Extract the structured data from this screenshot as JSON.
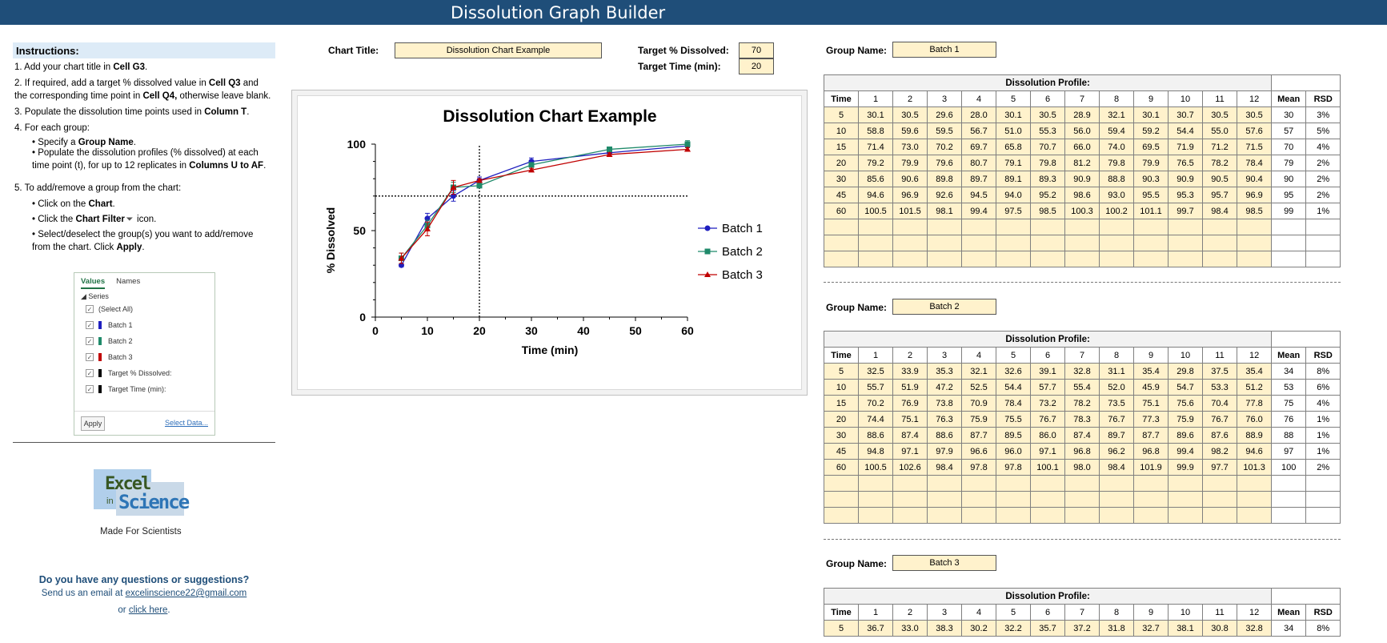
{
  "app": {
    "title": "Dissolution Graph Builder"
  },
  "instructions": {
    "heading": "Instructions:",
    "step1_pre": "1. Add your chart title in ",
    "step1_cell": "Cell G3",
    "step1_post": ".",
    "step2_pre": "2. If required, add a target % dissolved value in ",
    "step2_cell1": "Cell Q3",
    "step2_mid": " and the corresponding time point in ",
    "step2_cell2": "Cell Q4,",
    "step2_post": " otherwise leave blank.",
    "step3_pre": "3. Populate the dissolution time points used in ",
    "step3_cell": "Column T",
    "step3_post": ".",
    "step4": "4. For each group:",
    "step4a_pre": "• Specify a ",
    "step4a_b": "Group Name",
    "step4a_post": ".",
    "step4b_pre": "• Populate the dissolution profiles (% dissolved) at each time point (t), for up to 12 replicates in ",
    "step4b_b": "Columns U to AF",
    "step4b_post": ".",
    "step5": "5. To add/remove a group from the chart:",
    "step5a_pre": "• Click on the ",
    "step5a_b": "Chart",
    "step5a_post": ".",
    "step5b_pre": "• Click the ",
    "step5b_b": "Chart Filter",
    "step5b_post": " icon.",
    "step5c_pre": "• Select/deselect the group(s) you want to add/remove from the chart. Click ",
    "step5c_b": "Apply",
    "step5c_post": "."
  },
  "filter_panel": {
    "tabs": [
      "Values",
      "Names"
    ],
    "series_label": "◢ Series",
    "items": [
      {
        "label": "(Select All)",
        "color": ""
      },
      {
        "label": "Batch 1",
        "color": "#1f1fbf"
      },
      {
        "label": "Batch 2",
        "color": "#1f8a6a"
      },
      {
        "label": "Batch 3",
        "color": "#c00000"
      },
      {
        "label": "Target % Dissolved:",
        "color": "#000000"
      },
      {
        "label": "Target Time (min):",
        "color": "#000000"
      }
    ],
    "apply_label": "Apply",
    "select_data_label": "Select Data..."
  },
  "branding": {
    "logo_word1": "Excel",
    "logo_word2": "in",
    "logo_word3": "Science",
    "tagline": "Made For Scientists"
  },
  "contact": {
    "question": "Do you have any questions or suggestions?",
    "email_pre": "Send us an email at ",
    "email": "excelinscience22@gmail.com",
    "or_pre": "or ",
    "click_here": "click here",
    "or_post": "."
  },
  "chart_settings": {
    "title_label": "Chart Title:",
    "title_value": "Dissolution Chart Example",
    "target_pct_label": "Target % Dissolved:",
    "target_pct_value": "70",
    "target_time_label": "Target Time (min):",
    "target_time_value": "20"
  },
  "chart_data": {
    "type": "line",
    "title": "Dissolution Chart Example",
    "xlabel": "Time (min)",
    "ylabel": "% Dissolved",
    "xlim": [
      0,
      60
    ],
    "ylim": [
      0,
      100
    ],
    "xticks": [
      0,
      10,
      20,
      30,
      40,
      50,
      60
    ],
    "yticks": [
      0,
      50,
      100
    ],
    "x": [
      5,
      10,
      15,
      20,
      30,
      45,
      60
    ],
    "legend_position": "right",
    "target_pct": 70,
    "target_time": 20,
    "series": [
      {
        "name": "Batch 1",
        "color": "#1f1fbf",
        "marker": "circle",
        "values": [
          30,
          57,
          70,
          79,
          90,
          95,
          99
        ],
        "err": [
          1,
          3,
          3,
          2,
          2,
          2,
          1
        ]
      },
      {
        "name": "Batch 2",
        "color": "#1f8a6a",
        "marker": "square",
        "values": [
          34,
          53,
          75,
          76,
          88,
          97,
          100
        ],
        "err": [
          3,
          3,
          3,
          1,
          1,
          1,
          2
        ]
      },
      {
        "name": "Batch 3",
        "color": "#c00000",
        "marker": "triangle",
        "values": [
          34,
          51,
          75,
          79,
          85,
          94,
          97
        ],
        "err": [
          3,
          4,
          4,
          1,
          1,
          1,
          1
        ]
      }
    ]
  },
  "tables": {
    "caption": "Dissolution Profile:",
    "group_label": "Group Name:",
    "headers": [
      "Time",
      "1",
      "2",
      "3",
      "4",
      "5",
      "6",
      "7",
      "8",
      "9",
      "10",
      "11",
      "12",
      "Mean",
      "RSD"
    ],
    "groups": [
      {
        "name": "Batch 1",
        "rows": [
          [
            "5",
            "30.1",
            "30.5",
            "29.6",
            "28.0",
            "30.1",
            "30.5",
            "28.9",
            "32.1",
            "30.1",
            "30.7",
            "30.5",
            "30.5",
            "30",
            "3%"
          ],
          [
            "10",
            "58.8",
            "59.6",
            "59.5",
            "56.7",
            "51.0",
            "55.3",
            "56.0",
            "59.4",
            "59.2",
            "54.4",
            "55.0",
            "57.6",
            "57",
            "5%"
          ],
          [
            "15",
            "71.4",
            "73.0",
            "70.2",
            "69.7",
            "65.8",
            "70.7",
            "66.0",
            "74.0",
            "69.5",
            "71.9",
            "71.2",
            "71.5",
            "70",
            "4%"
          ],
          [
            "20",
            "79.2",
            "79.9",
            "79.6",
            "80.7",
            "79.1",
            "79.8",
            "81.2",
            "79.8",
            "79.9",
            "76.5",
            "78.2",
            "78.4",
            "79",
            "2%"
          ],
          [
            "30",
            "85.6",
            "90.6",
            "89.8",
            "89.7",
            "89.1",
            "89.3",
            "90.9",
            "88.8",
            "90.3",
            "90.9",
            "90.5",
            "90.4",
            "90",
            "2%"
          ],
          [
            "45",
            "94.6",
            "96.9",
            "92.6",
            "94.5",
            "94.0",
            "95.2",
            "98.6",
            "93.0",
            "95.5",
            "95.3",
            "95.7",
            "96.9",
            "95",
            "2%"
          ],
          [
            "60",
            "100.5",
            "101.5",
            "98.1",
            "99.4",
            "97.5",
            "98.5",
            "100.3",
            "100.2",
            "101.1",
            "99.7",
            "98.4",
            "98.5",
            "99",
            "1%"
          ],
          [
            "",
            "",
            "",
            "",
            "",
            "",
            "",
            "",
            "",
            "",
            "",
            "",
            "",
            "",
            ""
          ],
          [
            "",
            "",
            "",
            "",
            "",
            "",
            "",
            "",
            "",
            "",
            "",
            "",
            "",
            "",
            ""
          ],
          [
            "",
            "",
            "",
            "",
            "",
            "",
            "",
            "",
            "",
            "",
            "",
            "",
            "",
            "",
            ""
          ]
        ]
      },
      {
        "name": "Batch 2",
        "rows": [
          [
            "5",
            "32.5",
            "33.9",
            "35.3",
            "32.1",
            "32.6",
            "39.1",
            "32.8",
            "31.1",
            "35.4",
            "29.8",
            "37.5",
            "35.4",
            "34",
            "8%"
          ],
          [
            "10",
            "55.7",
            "51.9",
            "47.2",
            "52.5",
            "54.4",
            "57.7",
            "55.4",
            "52.0",
            "45.9",
            "54.7",
            "53.3",
            "51.2",
            "53",
            "6%"
          ],
          [
            "15",
            "70.2",
            "76.9",
            "73.8",
            "70.9",
            "78.4",
            "73.2",
            "78.2",
            "73.5",
            "75.1",
            "75.6",
            "70.4",
            "77.8",
            "75",
            "4%"
          ],
          [
            "20",
            "74.4",
            "75.1",
            "76.3",
            "75.9",
            "75.5",
            "76.7",
            "78.3",
            "76.7",
            "77.3",
            "75.9",
            "76.7",
            "76.0",
            "76",
            "1%"
          ],
          [
            "30",
            "88.6",
            "87.4",
            "88.6",
            "87.7",
            "89.5",
            "86.0",
            "87.4",
            "89.7",
            "87.7",
            "89.6",
            "87.6",
            "88.9",
            "88",
            "1%"
          ],
          [
            "45",
            "94.8",
            "97.1",
            "97.9",
            "96.6",
            "96.0",
            "97.1",
            "96.8",
            "96.2",
            "96.8",
            "99.4",
            "98.2",
            "94.6",
            "97",
            "1%"
          ],
          [
            "60",
            "100.5",
            "102.6",
            "98.4",
            "97.8",
            "97.8",
            "100.1",
            "98.0",
            "98.4",
            "101.9",
            "99.9",
            "97.7",
            "101.3",
            "100",
            "2%"
          ],
          [
            "",
            "",
            "",
            "",
            "",
            "",
            "",
            "",
            "",
            "",
            "",
            "",
            "",
            "",
            ""
          ],
          [
            "",
            "",
            "",
            "",
            "",
            "",
            "",
            "",
            "",
            "",
            "",
            "",
            "",
            "",
            ""
          ],
          [
            "",
            "",
            "",
            "",
            "",
            "",
            "",
            "",
            "",
            "",
            "",
            "",
            "",
            "",
            ""
          ]
        ]
      },
      {
        "name": "Batch 3",
        "rows": [
          [
            "5",
            "36.7",
            "33.0",
            "38.3",
            "30.2",
            "32.2",
            "35.7",
            "37.2",
            "31.8",
            "32.7",
            "38.1",
            "30.8",
            "32.8",
            "34",
            "8%"
          ]
        ]
      }
    ]
  }
}
